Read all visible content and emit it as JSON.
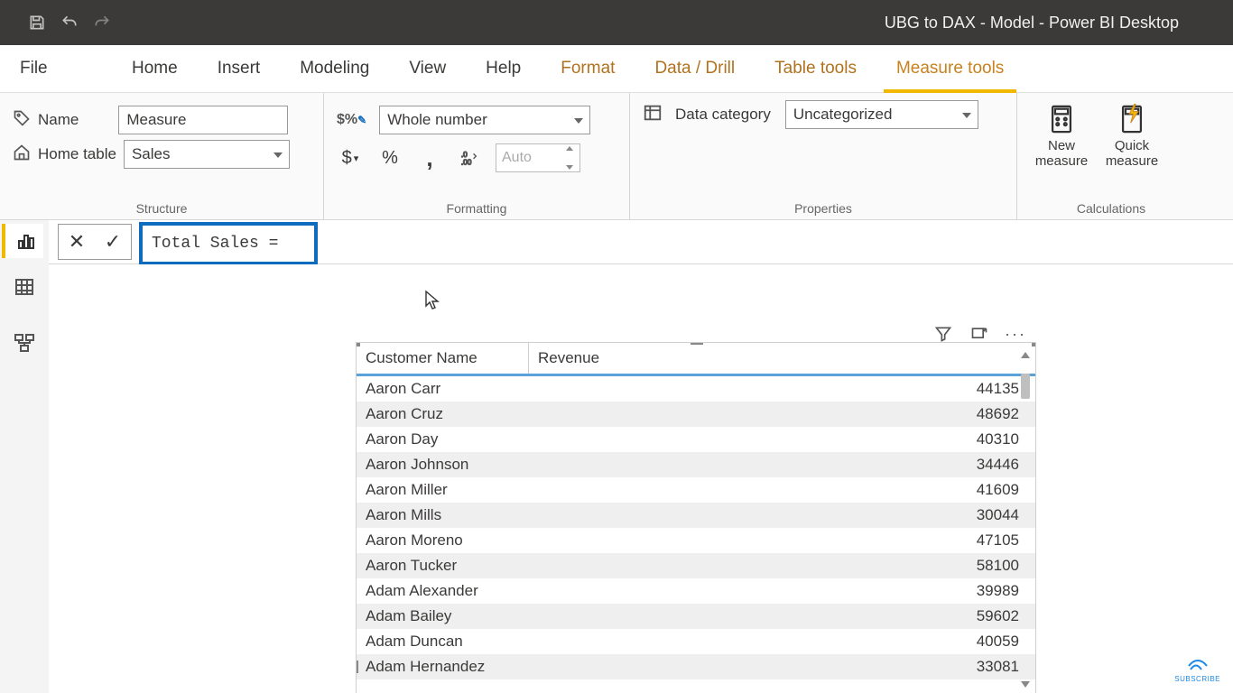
{
  "titlebar": {
    "title": "UBG to DAX - Model - Power BI Desktop"
  },
  "tabs": {
    "file": "File",
    "items": [
      {
        "label": "Home",
        "cls": ""
      },
      {
        "label": "Insert",
        "cls": ""
      },
      {
        "label": "Modeling",
        "cls": ""
      },
      {
        "label": "View",
        "cls": ""
      },
      {
        "label": "Help",
        "cls": ""
      },
      {
        "label": "Format",
        "cls": "ctx1"
      },
      {
        "label": "Data / Drill",
        "cls": "ctx1"
      },
      {
        "label": "Table tools",
        "cls": "ctx2"
      },
      {
        "label": "Measure tools",
        "cls": "ctx2 active"
      }
    ]
  },
  "ribbon": {
    "structure": {
      "label": "Structure",
      "name_label": "Name",
      "name_value": "Measure",
      "home_table_label": "Home table",
      "home_table_value": "Sales"
    },
    "formatting": {
      "label": "Formatting",
      "format_value": "Whole number",
      "currency": "$",
      "percent": "%",
      "thousands": ",",
      "decimals_icon": ".00",
      "auto_label": "Auto"
    },
    "properties": {
      "label": "Properties",
      "data_category_label": "Data category",
      "data_category_value": "Uncategorized"
    },
    "calculations": {
      "label": "Calculations",
      "new_measure": "New measure",
      "quick_measure": "Quick measure"
    }
  },
  "formula_bar": {
    "expression": "Total Sales ="
  },
  "table": {
    "headers": {
      "c0": "Customer Name",
      "c1": "Revenue"
    },
    "rows": [
      {
        "name": "Aaron Carr",
        "rev": "44135"
      },
      {
        "name": "Aaron Cruz",
        "rev": "48692"
      },
      {
        "name": "Aaron Day",
        "rev": "40310"
      },
      {
        "name": "Aaron Johnson",
        "rev": "34446"
      },
      {
        "name": "Aaron Miller",
        "rev": "41609"
      },
      {
        "name": "Aaron Mills",
        "rev": "30044"
      },
      {
        "name": "Aaron Moreno",
        "rev": "47105"
      },
      {
        "name": "Aaron Tucker",
        "rev": "58100"
      },
      {
        "name": "Adam Alexander",
        "rev": "39989"
      },
      {
        "name": "Adam Bailey",
        "rev": "59602"
      },
      {
        "name": "Adam Duncan",
        "rev": "40059"
      },
      {
        "name": "Adam Hernandez",
        "rev": "33081"
      }
    ]
  },
  "badge": {
    "label": "SUBSCRIBE"
  }
}
